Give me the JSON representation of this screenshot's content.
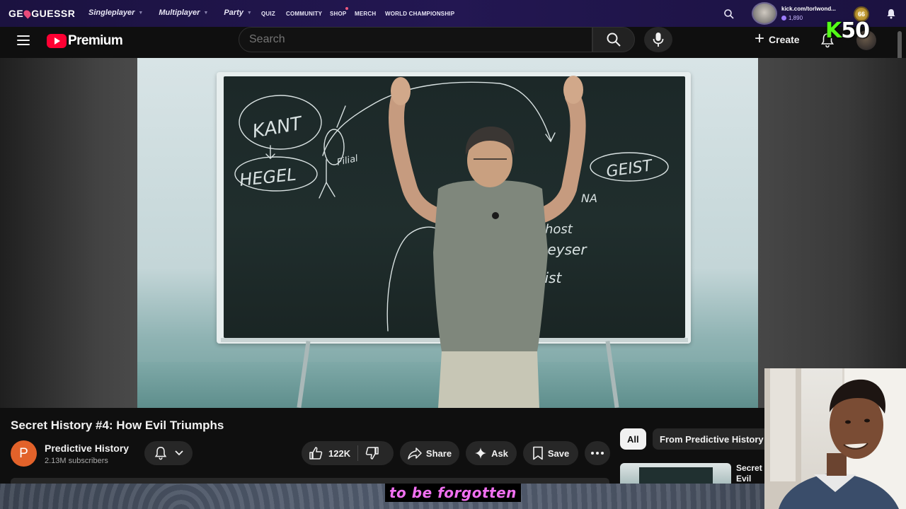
{
  "geoguessr": {
    "logo_pre": "GE",
    "logo_post": "GUESSR",
    "nav": [
      {
        "label": "Singleplayer"
      },
      {
        "label": "Multiplayer"
      },
      {
        "label": "Party"
      }
    ],
    "nav_small": [
      "QUIZ",
      "COMMUNITY",
      "SHOP",
      "MERCH",
      "WORLD CHAMPIONSHIP"
    ],
    "username": "kick.com/torlwond...",
    "coins": "1,890",
    "level": "66"
  },
  "youtube": {
    "logo_text": "Premium",
    "search_placeholder": "Search",
    "create_label": "Create"
  },
  "overlay": {
    "kick_k": "K",
    "kick_number": "50",
    "caption": "to be forgotten"
  },
  "board_text": {
    "kant": "KANT",
    "hegel": "HEGEL",
    "geist": "GEIST",
    "filial": "Filial",
    "ghost": "Ghost",
    "geyser": "Geyser",
    "gist": "Gist",
    "na": "NA"
  },
  "video": {
    "title": "Secret History #4: How Evil Triumphs",
    "channel_initial": "P",
    "channel_name": "Predictive History",
    "subscribers": "2.13M subscribers",
    "likes": "122K",
    "share_label": "Share",
    "ask_label": "Ask",
    "save_label": "Save"
  },
  "recommendations": {
    "chips": [
      "All",
      "From Predictive History"
    ],
    "first_title": "Secret Evil"
  },
  "colors": {
    "geo_bg": "#1b1240",
    "yt_bg": "#0f0f0f",
    "yt_red": "#ff0033",
    "caption_text": "#f070f0",
    "kick_green": "#53fc18",
    "channel_avatar": "#e2622a"
  }
}
